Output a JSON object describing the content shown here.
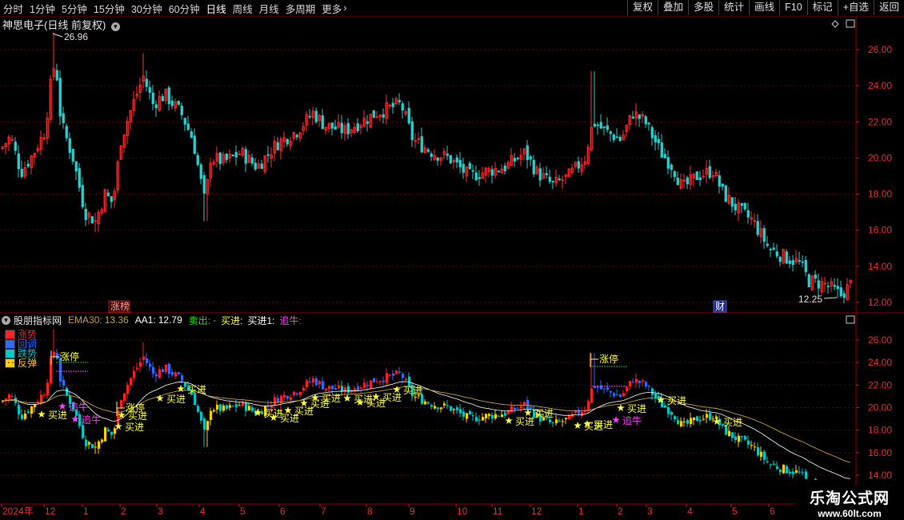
{
  "toolbar": {
    "periods": [
      "分时",
      "1分钟",
      "5分钟",
      "15分钟",
      "30分钟",
      "60分钟",
      "日线",
      "周线",
      "月线",
      "多周期",
      "更多"
    ],
    "active_period": "日线",
    "more_icon": "chevron-right-icon",
    "buttons": [
      "复权",
      "叠加",
      "多股",
      "统计",
      "画线",
      "F10",
      "标记",
      "+自选",
      "返回"
    ]
  },
  "main_chart": {
    "title": "神思电子(日线 前复权)",
    "dropdown_icon": "chevron-down-circle-icon",
    "high_label": "26.96",
    "low_label": "12.25",
    "event_tags": [
      "涨榜",
      "财"
    ],
    "y_ticks": [
      "26.00",
      "24.00",
      "22.00",
      "20.00",
      "18.00",
      "16.00",
      "14.00",
      "12.00"
    ],
    "colors": {
      "up": "#ff3333",
      "down": "#33cccc",
      "grid": "#660000",
      "axis": "#ff3030"
    }
  },
  "indicator": {
    "name": "股朋指标网",
    "ema30_label": "EMA30:",
    "ema30_value": "13.36",
    "aa1_label": "AA1:",
    "aa1_value": "12.79",
    "sell_label": "卖出:",
    "sell_value": "-",
    "buy_label": "买进:",
    "buy1_label": "买进1:",
    "chase_label": "追牛:",
    "legend": [
      {
        "label": "涨势",
        "color": "#ff2020"
      },
      {
        "label": "回调",
        "color": "#2a6cff"
      },
      {
        "label": "跌势",
        "color": "#00c8c8"
      },
      {
        "label": "反弹",
        "color": "#ffd000"
      }
    ],
    "signal_labels": {
      "limit_up": "涨停",
      "buy": "买进",
      "chase": "追牛"
    },
    "y_ticks": [
      "26.00",
      "24.00",
      "22.00",
      "20.00",
      "18.00",
      "16.00",
      "14.00"
    ]
  },
  "time_axis": {
    "labels": [
      "2024年",
      "12",
      "1",
      "2",
      "3",
      "4",
      "5",
      "6",
      "7",
      "8",
      "9",
      "10",
      "11",
      "12",
      "1",
      "2",
      "3",
      "4",
      "5",
      "6"
    ]
  },
  "watermark": {
    "title": "乐淘公式网",
    "url": "www.60lt.com"
  }
}
